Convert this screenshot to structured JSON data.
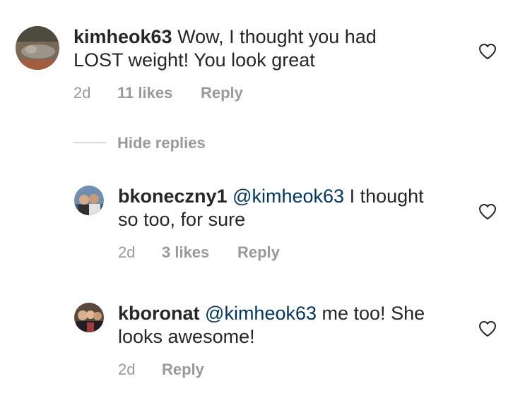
{
  "comments": [
    {
      "username": "kimheok63",
      "mention": "",
      "text": "Wow, I thought you had",
      "text_line2": "LOST weight!  You look great",
      "age": "2d",
      "likes": "11 likes",
      "reply": "Reply"
    }
  ],
  "hide_replies_label": "Hide replies",
  "replies": [
    {
      "username": "bkoneczny1",
      "mention": "@kimheok63",
      "text": " I thought",
      "text_line2": "so too, for sure",
      "age": "2d",
      "likes": "3 likes",
      "reply": "Reply"
    },
    {
      "username": "kboronat",
      "mention": "@kimheok63",
      "text": " me too! She",
      "text_line2": "looks awesome!",
      "age": "2d",
      "likes": "",
      "reply": "Reply"
    }
  ],
  "icons": {
    "like": "heart-outline-icon"
  },
  "colors": {
    "text": "#262626",
    "muted": "#999999",
    "mention": "#003569"
  }
}
